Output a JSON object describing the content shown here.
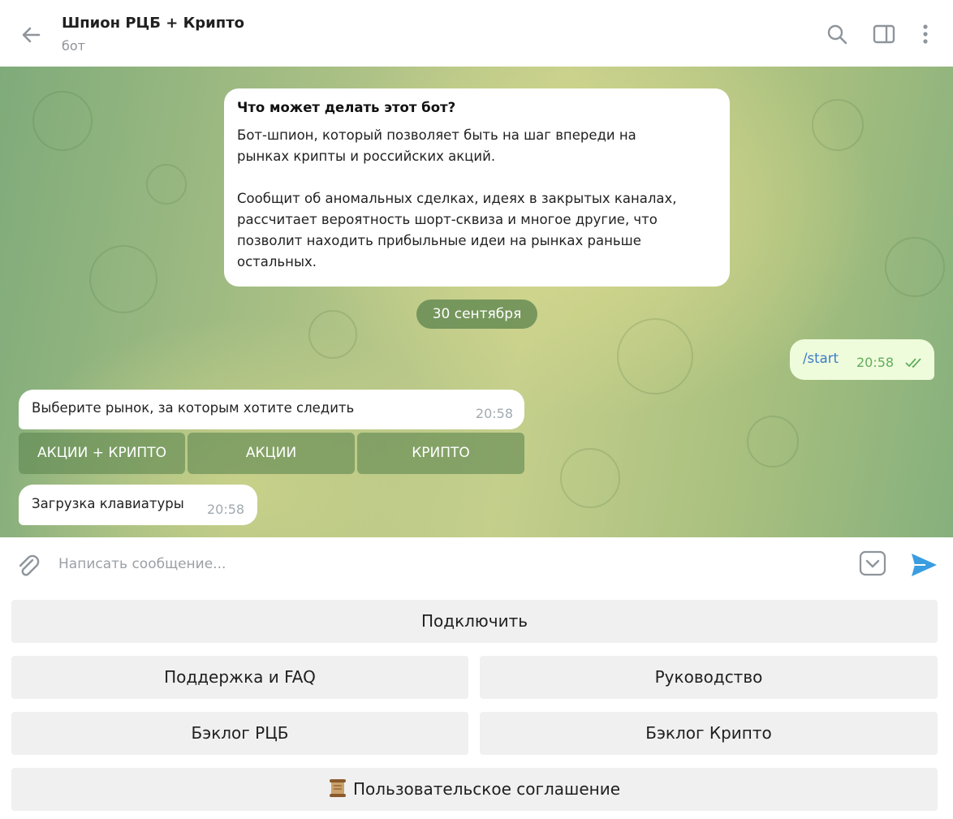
{
  "header": {
    "title": "Шпион РЦБ + Крипто",
    "subtitle": "бот",
    "icons": [
      "back-arrow-icon",
      "search-icon",
      "sidebar-toggle-icon",
      "more-vertical-icon"
    ]
  },
  "chat": {
    "intro": {
      "title": "Что может делать этот бот?",
      "text": "Бот-шпион, который позволяет быть на шаг впереди на\nрынках крипты и российских акций.\n\nСообщит об аномальных сделках, идеях в закрытых каналах,\nрассчитает вероятность шорт-сквиза и многое другие, что\nпозволит находить прибыльные идеи на рынках раньше\nостальных."
    },
    "date": "30 сентября",
    "outgoing": {
      "text": "/start",
      "time": "20:58"
    },
    "bot_message": {
      "text": "Выберите рынок, за которым хотите следить",
      "time": "20:58",
      "inline_buttons": [
        "АКЦИИ + КРИПТО",
        "АКЦИИ",
        "КРИПТО"
      ]
    },
    "loading_message": {
      "text": "Загрузка клавиатуры",
      "time": "20:58"
    }
  },
  "composer": {
    "placeholder": "Написать сообщение..."
  },
  "reply_keyboard": {
    "connect": "Подключить",
    "support": "Поддержка и FAQ",
    "guide": "Руководство",
    "backlog_rcb": "Бэклог РЦБ",
    "backlog_crypto": "Бэклог Крипто",
    "agreement": "Пользовательское соглашение"
  },
  "colors": {
    "outgoing_bubble": "#effcdc",
    "link": "#3a7bc8",
    "checkmarks": "#5fae5b",
    "send": "#3a9de0"
  }
}
